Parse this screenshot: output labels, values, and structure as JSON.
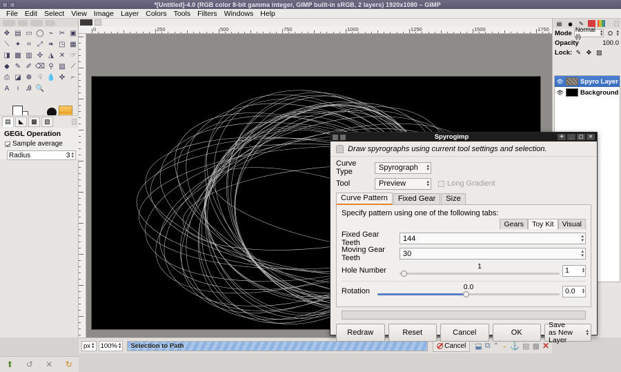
{
  "window": {
    "title": "*[Untitled]-4.0 (RGB color 8-bit gamma integer, GIMP built-in sRGB, 2 layers) 1920x1080 – GIMP"
  },
  "menubar": {
    "items": [
      "File",
      "Edit",
      "Select",
      "View",
      "Image",
      "Layer",
      "Colors",
      "Tools",
      "Filters",
      "Windows",
      "Help"
    ]
  },
  "toolbox": {
    "gegl": {
      "title": "GEGL Operation",
      "sample_average_label": "Sample average",
      "radius_label": "Radius",
      "radius_value": "3"
    }
  },
  "canvas": {
    "ruler_labels": [
      "0",
      "250",
      "500",
      "750",
      "1000",
      "1250",
      "1500",
      "1750"
    ],
    "background_color": "#000000",
    "curve_color": "#d8d8d8"
  },
  "statusbar": {
    "unit": "px",
    "zoom": "100%",
    "progress_text": "Selection to Path",
    "cancel_label": "Cancel"
  },
  "layers_dock": {
    "mode_label": "Mode",
    "mode_value": "Normal (l)",
    "opacity_label": "Opacity",
    "opacity_value": "100.0",
    "lock_label": "Lock:",
    "layers": [
      {
        "name": "Spyro Layer",
        "selected": true,
        "visible": true
      },
      {
        "name": "Background",
        "selected": false,
        "visible": true
      }
    ]
  },
  "spyrogimp": {
    "title": "Spyrogimp",
    "description": "Draw spyrographs using current tool settings and selection.",
    "curve_type_label": "Curve Type",
    "curve_type_value": "Spyrograph",
    "tool_label": "Tool",
    "tool_value": "Preview",
    "long_gradient_label": "Long Gradient",
    "tabs": [
      {
        "label": "Curve Pattern",
        "selected": true
      },
      {
        "label": "Fixed Gear",
        "selected": false
      },
      {
        "label": "Size",
        "selected": false
      }
    ],
    "specify_text": "Specify pattern using one of the following tabs:",
    "subtabs": [
      {
        "label": "Gears",
        "selected": false
      },
      {
        "label": "Toy Kit",
        "selected": true
      },
      {
        "label": "Visual",
        "selected": false
      }
    ],
    "fixed_gear_teeth_label": "Fixed Gear Teeth",
    "fixed_gear_teeth_value": "144",
    "moving_gear_teeth_label": "Moving Gear Teeth",
    "moving_gear_teeth_value": "30",
    "hole_number_label": "Hole Number",
    "hole_number_value": "1",
    "hole_number_box": "1",
    "rotation_label": "Rotation",
    "rotation_value": "0.0",
    "rotation_box": "0.0",
    "buttons": {
      "redraw": "Redraw",
      "reset": "Reset",
      "cancel": "Cancel",
      "ok": "OK",
      "save_line1": "Save",
      "save_line2": "as New Layer"
    }
  }
}
